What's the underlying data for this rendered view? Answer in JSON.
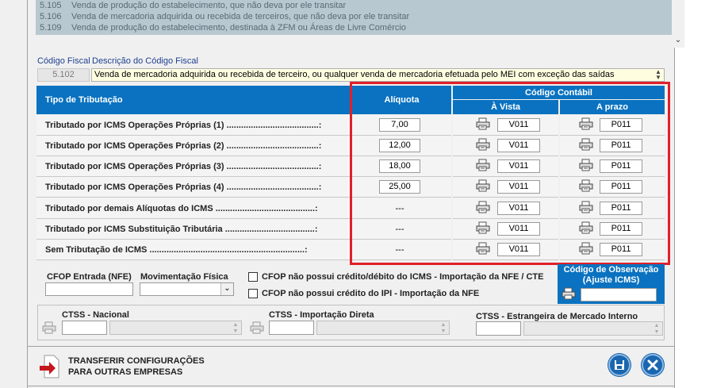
{
  "cfop_list": [
    {
      "code": "5.105",
      "desc": "Venda de produção do estabelecimento, que não deva por ele transitar"
    },
    {
      "code": "5.106",
      "desc": "Venda de mercadoria adquirida ou recebida de terceiros, que não deva por ele transitar"
    },
    {
      "code": "5.109",
      "desc": "Venda de produção do estabelecimento, destinada à ZFM ou Áreas de Livre Comércio"
    }
  ],
  "fiscal": {
    "code_label": "Código Fiscal",
    "desc_label": "Descrição do Código Fiscal",
    "code": "5.102",
    "desc": "Venda de mercadoria adquirida ou recebida de terceiro, ou qualquer venda de mercadoria efetuada pelo MEI com exceção das saídas"
  },
  "table": {
    "header_tipo": "Tipo de Tributação",
    "header_aliquota": "Alíquota",
    "header_codigo": "Código Contábil",
    "header_avista": "À Vista",
    "header_aprazo": "A prazo",
    "rows": [
      {
        "label": "Tributado por ICMS Operações Próprias (1) ......................................:",
        "aliquota": "7,00",
        "avista": "V011",
        "aprazo": "P011"
      },
      {
        "label": "Tributado por ICMS Operações Próprias (2) ......................................:",
        "aliquota": "12,00",
        "avista": "V011",
        "aprazo": "P011"
      },
      {
        "label": "Tributado por ICMS Operações Próprias (3) ......................................:",
        "aliquota": "18,00",
        "avista": "V011",
        "aprazo": "P011"
      },
      {
        "label": "Tributado por ICMS Operações Próprias (4) ......................................:",
        "aliquota": "25,00",
        "avista": "V011",
        "aprazo": "P011"
      },
      {
        "label": "Tributado por demais Alíquotas do ICMS .........................................:",
        "aliquota": "---",
        "avista": "V011",
        "aprazo": "P011"
      },
      {
        "label": "Tributado por ICMS Substituição Tributária .....................................:",
        "aliquota": "---",
        "avista": "V011",
        "aprazo": "P011"
      },
      {
        "label": "Sem Tributação de ICMS ................................................................:",
        "aliquota": "---",
        "avista": "V011",
        "aprazo": "P011"
      }
    ]
  },
  "bottom": {
    "cfop_entrada_label": "CFOP Entrada (NFE)",
    "mov_fisica_label": "Movimentação Física",
    "cfop_entrada_value": "",
    "mov_fisica_value": "",
    "check1_label": "CFOP não possui crédito/débito do ICMS -  Importação da NFE / CTE",
    "check2_label": "CFOP não possui crédito do IPI - Importação da NFE",
    "obs_title": "Código de Observação (Ajuste ICMS)",
    "obs_value": ""
  },
  "ctss": {
    "nacional_label": "CTSS - Nacional",
    "importacao_label": "CTSS - Importação Direta",
    "estrangeira_label": "CTSS - Estrangeira de Mercado Interno"
  },
  "footer": {
    "transfer_line1": "TRANSFERIR CONFIGURAÇÕES",
    "transfer_line2": "PARA OUTRAS EMPRESAS"
  },
  "colors": {
    "header_blue": "#0a72c0",
    "highlight_red": "#e0202a"
  },
  "icons": [
    "printer-icon",
    "save-icon",
    "close-icon",
    "transfer-arrow-icon",
    "chevron-down-icon"
  ]
}
